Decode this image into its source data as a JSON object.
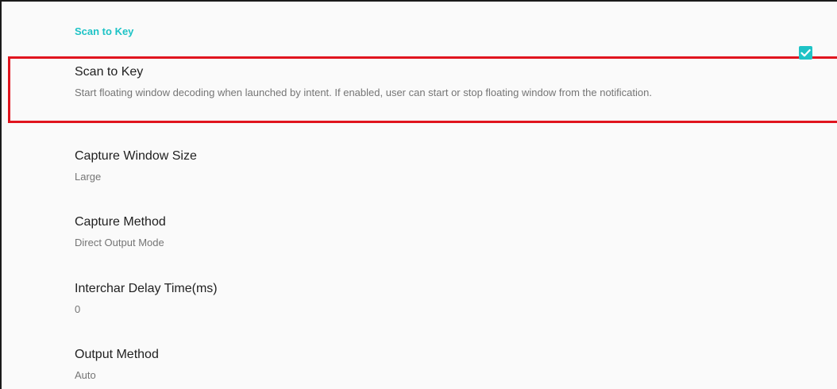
{
  "section": {
    "category_title": "Scan to Key"
  },
  "preferences": [
    {
      "title": "Scan to Key",
      "summary": "Start floating window decoding when launched by intent. If enabled, user can start or stop floating window from the notification.",
      "checked": true,
      "checkbox_icon": "checkmark-icon"
    },
    {
      "title": "Capture Window Size",
      "summary": "Large"
    },
    {
      "title": "Capture Method",
      "summary": "Direct Output Mode"
    },
    {
      "title": "Interchar Delay Time(ms)",
      "summary": "0"
    },
    {
      "title": "Output Method",
      "summary": "Auto"
    }
  ],
  "colors": {
    "accent": "#1ec3c6",
    "highlight_border": "#e0141e",
    "title_text": "#212121",
    "summary_text": "#757575"
  }
}
